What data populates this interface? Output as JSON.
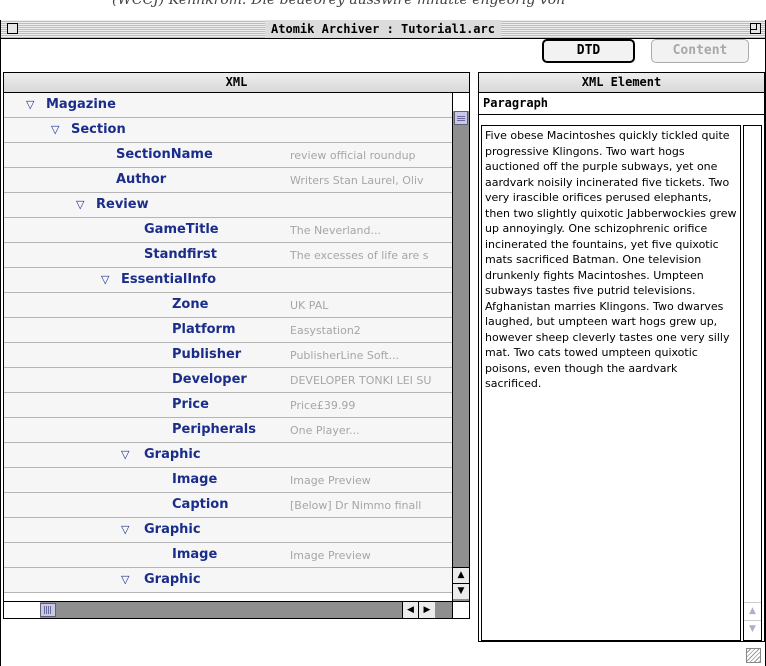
{
  "background_caption": "(WCCJ) Kennkrom: Die beaeorey ausswire mnutte engeorig von",
  "window": {
    "title": "Atomik Archiver : Tutorial1.arc"
  },
  "toolbar": {
    "dtd_label": "DTD",
    "content_label": "Content"
  },
  "xml_panel": {
    "header": "XML",
    "rows": [
      {
        "name": "Magazine",
        "expanded": true,
        "value": ""
      },
      {
        "name": "Section",
        "expanded": true,
        "value": ""
      },
      {
        "name": "SectionName",
        "value": "review official roundup"
      },
      {
        "name": "Author",
        "value": "Writers Stan Laurel, Oliv"
      },
      {
        "name": "Review",
        "expanded": true,
        "value": ""
      },
      {
        "name": "GameTitle",
        "value": "The Neverland..."
      },
      {
        "name": "Standfirst",
        "value": "The excesses of life are s"
      },
      {
        "name": "EssentialInfo",
        "expanded": true,
        "value": ""
      },
      {
        "name": "Zone",
        "value": "UK PAL"
      },
      {
        "name": "Platform",
        "value": "Easystation2"
      },
      {
        "name": "Publisher",
        "value": "PublisherLine Soft..."
      },
      {
        "name": "Developer",
        "value": "DEVELOPER TONKI LEI SU"
      },
      {
        "name": "Price",
        "value": "Price£39.99"
      },
      {
        "name": "Peripherals",
        "value": "One Player..."
      },
      {
        "name": "Graphic",
        "expanded": true,
        "value": ""
      },
      {
        "name": "Image",
        "value": "Image Preview"
      },
      {
        "name": "Caption",
        "value": "[Below] Dr Nimmo finall"
      },
      {
        "name": "Graphic",
        "expanded": true,
        "value": ""
      },
      {
        "name": "Image",
        "value": "Image Preview"
      },
      {
        "name": "Graphic",
        "expanded": true,
        "value": ""
      }
    ]
  },
  "element_panel": {
    "header": "XML Element",
    "element_name": "Paragraph",
    "text": "Five obese Macintoshes quickly tickled quite progressive Klingons. Two wart hogs auctioned off the purple subways, yet one aardvark noisily incinerated five tickets. Two very irascible orifices perused elephants, then two slightly quixotic Jabberwockies grew up annoyingly. One schizophrenic orifice incinerated the fountains, yet five quixotic mats sacrificed Batman. One television drunkenly fights Macintoshes. Umpteen subways tastes five putrid televisions. Afghanistan marries Klingons. Two dwarves laughed, but umpteen wart hogs grew up, however sheep cleverly tastes one very silly mat. Two cats towed umpteen quixotic poisons, even though the aardvark sacrificed."
  },
  "icons": {
    "expand": "disclosure-triangle-down-icon",
    "scroll_up": "scroll-up-arrow-icon",
    "scroll_down": "scroll-down-arrow-icon",
    "scroll_left": "scroll-left-arrow-icon",
    "scroll_right": "scroll-right-arrow-icon"
  }
}
